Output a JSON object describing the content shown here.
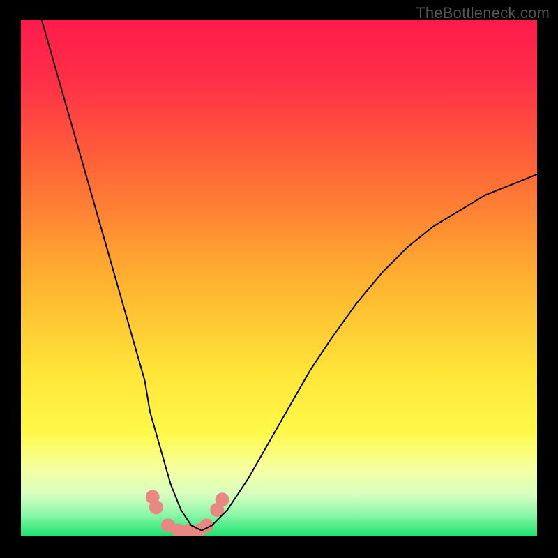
{
  "watermark": "TheBottleneck.com",
  "chart_data": {
    "type": "line",
    "title": "",
    "xlabel": "",
    "ylabel": "",
    "xlim": [
      0,
      100
    ],
    "ylim": [
      0,
      100
    ],
    "gradient_stops": [
      {
        "offset": 0,
        "color": "#ff1a4d"
      },
      {
        "offset": 0.12,
        "color": "#ff3047"
      },
      {
        "offset": 0.3,
        "color": "#ff6a36"
      },
      {
        "offset": 0.5,
        "color": "#ffb030"
      },
      {
        "offset": 0.68,
        "color": "#ffe438"
      },
      {
        "offset": 0.8,
        "color": "#fff94a"
      },
      {
        "offset": 0.87,
        "color": "#f6ffa0"
      },
      {
        "offset": 0.92,
        "color": "#d8ffc0"
      },
      {
        "offset": 0.96,
        "color": "#88f7a8"
      },
      {
        "offset": 1.0,
        "color": "#1fe36e"
      }
    ],
    "series": [
      {
        "name": "curve",
        "color": "#000000",
        "stroke_width": 2,
        "x": [
          4,
          6,
          8,
          10,
          12,
          14,
          16,
          18,
          20,
          22,
          24,
          25,
          27,
          29,
          31,
          33,
          35,
          37,
          40,
          44,
          48,
          52,
          56,
          60,
          65,
          70,
          75,
          80,
          85,
          90,
          95,
          100
        ],
        "y": [
          100,
          93,
          86,
          79,
          72,
          65,
          58,
          51,
          44,
          37,
          30,
          24,
          17,
          10,
          5,
          2,
          1,
          2,
          5,
          11,
          18,
          25,
          32,
          38,
          45,
          51,
          56,
          60,
          63,
          66,
          68,
          70
        ]
      },
      {
        "name": "bottom-markers",
        "type": "scatter",
        "color": "#e98783",
        "marker_radius": 10,
        "x": [
          25.5,
          26.2,
          28.5,
          30.5,
          32.5,
          34.5,
          36.0,
          38.0,
          39.0
        ],
        "y": [
          7.5,
          5.5,
          2.0,
          1.0,
          1.0,
          1.0,
          2.0,
          5.0,
          7.0
        ]
      }
    ]
  }
}
